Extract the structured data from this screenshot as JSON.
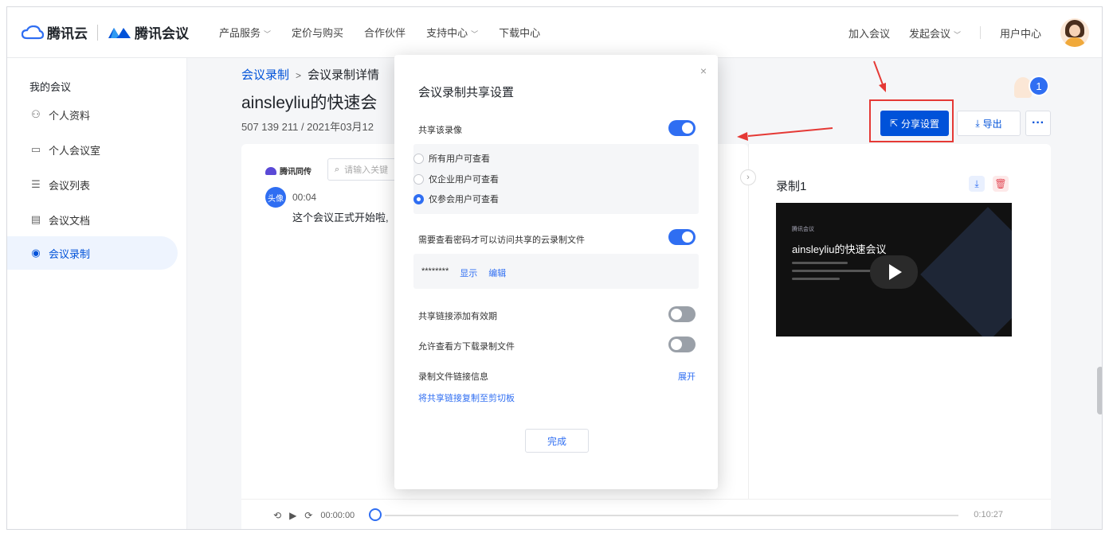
{
  "header": {
    "brand_cloud": "腾讯云",
    "brand_meeting": "腾讯会议",
    "nav": [
      {
        "label": "产品服务",
        "chevron": true
      },
      {
        "label": "定价与购买",
        "chevron": false
      },
      {
        "label": "合作伙伴",
        "chevron": false
      },
      {
        "label": "支持中心",
        "chevron": true
      },
      {
        "label": "下载中心",
        "chevron": false
      }
    ],
    "join_meeting": "加入会议",
    "start_meeting": "发起会议",
    "user_center": "用户中心"
  },
  "sidebar": {
    "title": "我的会议",
    "items": [
      {
        "label": "个人资料",
        "icon": "user-icon",
        "glyph": "⚇"
      },
      {
        "label": "个人会议室",
        "icon": "room-icon",
        "glyph": "▭"
      },
      {
        "label": "会议列表",
        "icon": "list-icon",
        "glyph": "☰"
      },
      {
        "label": "会议文档",
        "icon": "document-icon",
        "glyph": "▤"
      },
      {
        "label": "会议录制",
        "icon": "record-icon",
        "glyph": "◉"
      }
    ],
    "active_index": 4
  },
  "main": {
    "breadcrumb_link": "会议录制",
    "breadcrumb_sep": ">",
    "breadcrumb_current": "会议录制详情",
    "title": "ainsleyliu的快速会",
    "meta": "507 139 211  /  2021年03月12",
    "transcript": {
      "logo": "腾讯同传",
      "search_placeholder": "请输入关键",
      "speaker": "头像",
      "time": "00:04",
      "text": "这个会议正式开始啦,"
    },
    "player": {
      "current_time": "00:00:00",
      "end_time": "0:10:27"
    },
    "recording": {
      "title": "录制1",
      "thumb_title": "ainsleyliu的快速会议",
      "thumb_logo": "腾讯会议"
    },
    "badge_count": "1",
    "share_button": "分享设置",
    "export_button": "导出",
    "more_button": "···"
  },
  "modal": {
    "title": "会议录制共享设置",
    "close": "×",
    "share_video_label": "共享该录像",
    "share_video_on": true,
    "options": [
      {
        "label": "所有用户可查看",
        "selected": false
      },
      {
        "label": "仅企业用户可查看",
        "selected": false
      },
      {
        "label": "仅参会用户可查看",
        "selected": true
      }
    ],
    "password_label": "需要查看密码才可以访问共享的云录制文件",
    "password_on": true,
    "password_mask": "********",
    "show_link": "显示",
    "edit_link": "编辑",
    "expire_label": "共享链接添加有效期",
    "expire_on": false,
    "download_label": "允许查看方下载录制文件",
    "download_on": false,
    "link_info_label": "录制文件链接信息",
    "expand_link": "展开",
    "copy_link": "将共享链接复制至剪切板",
    "done_button": "完成"
  },
  "colors": {
    "primary": "#0052d9",
    "accent_blue": "#2f6ef2",
    "annotation_red": "#e53935"
  }
}
